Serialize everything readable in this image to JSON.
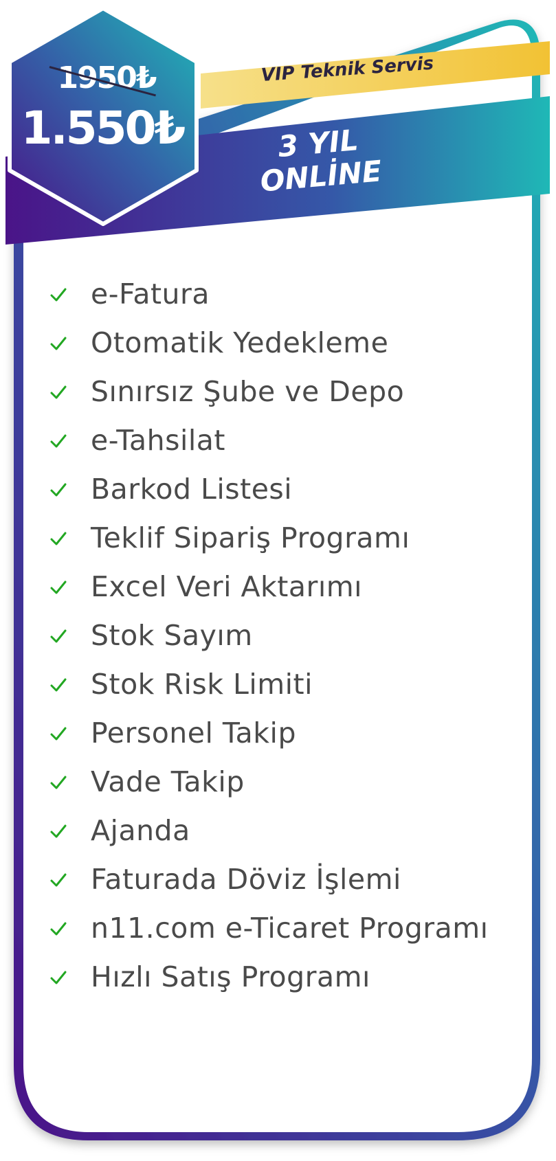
{
  "pricing": {
    "old_price": "1950₺",
    "new_price": "1.550₺"
  },
  "plan": {
    "badge": "VIP Teknik Servis",
    "title_line1": "3 YIL",
    "title_line2": "ONLİNE"
  },
  "features": [
    "e-Fatura",
    "Otomatik Yedekleme",
    "Sınırsız Şube ve Depo",
    "e-Tahsilat",
    "Barkod Listesi",
    "Teklif Sipariş Programı",
    "Excel Veri Aktarımı",
    "Stok Sayım",
    "Stok Risk Limiti",
    "Personel Takip",
    "Vade Takip",
    "Ajanda",
    "Faturada Döviz İşlemi",
    "n11.com e-Ticaret Programı",
    "Hızlı Satış Programı"
  ],
  "icons": {
    "feature_check": "check-icon"
  },
  "colors": {
    "gradient_start": "#4a1488",
    "gradient_mid": "#3558a8",
    "gradient_end": "#1fb8b6",
    "gold_light": "#f6e08a",
    "gold_dark": "#f2c234",
    "check_color": "#22a722",
    "text_color": "#4a4a4a"
  }
}
